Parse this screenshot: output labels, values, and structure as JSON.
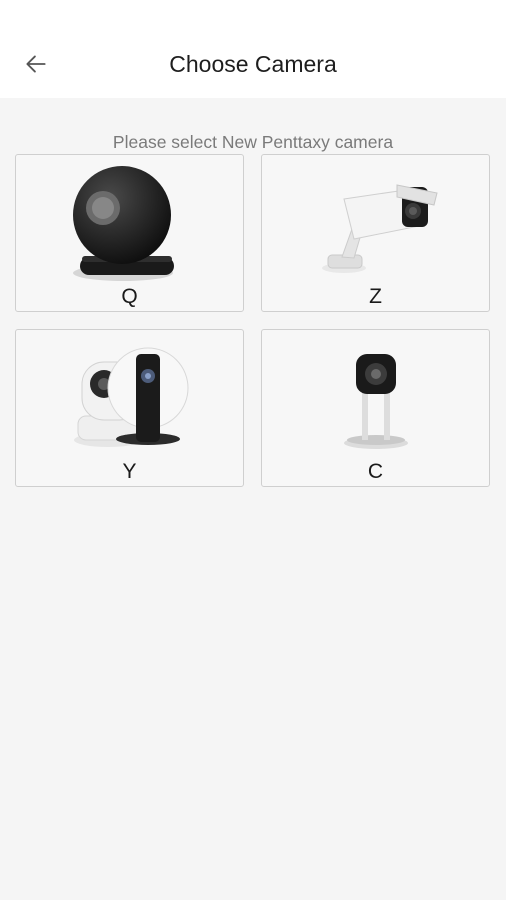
{
  "header": {
    "title": "Choose Camera",
    "back_icon": "arrow-left-icon"
  },
  "subtitle": "Please select New Penttaxy camera",
  "cameras": [
    {
      "label": "Q",
      "image": "black-sphere-camera"
    },
    {
      "label": "Z",
      "image": "white-bullet-camera"
    },
    {
      "label": "Y",
      "image": "pan-tilt-and-round-cameras"
    },
    {
      "label": "C",
      "image": "stand-mounted-camera"
    }
  ],
  "colors": {
    "header_bg": "#ffffff",
    "page_bg": "#f5f5f5",
    "card_border": "#cfcfcf",
    "subtitle_text": "#7a7a7a"
  }
}
